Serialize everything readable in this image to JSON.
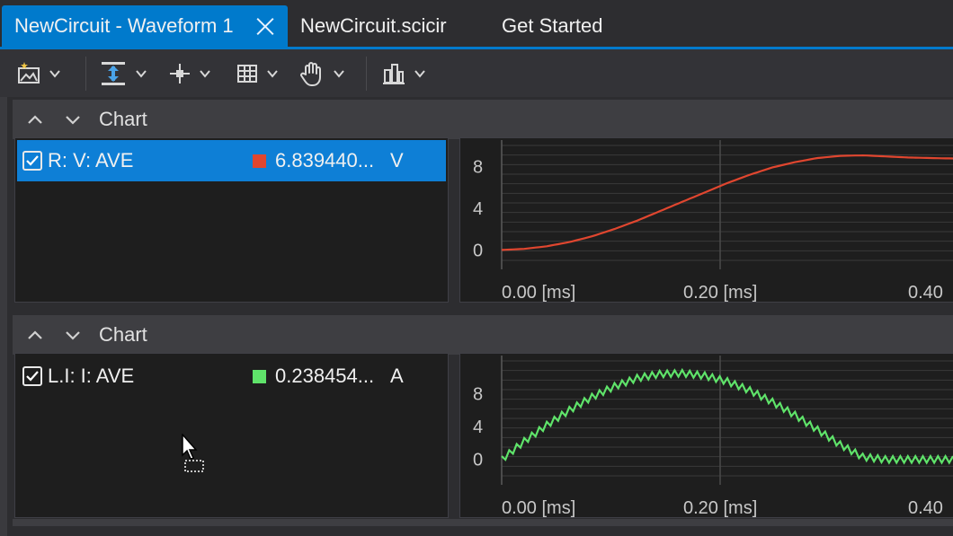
{
  "tabs": [
    {
      "label": "NewCircuit - Waveform 1",
      "active": true
    },
    {
      "label": "NewCircuit.scicir",
      "active": false
    },
    {
      "label": "Get Started",
      "active": false
    }
  ],
  "toolbar": {
    "buttons": [
      "add-image-icon",
      "fit-vertical-icon",
      "cursor-icon",
      "grid-icon",
      "pan-hand-icon",
      "bar-chart-icon"
    ]
  },
  "panels": [
    {
      "title": "Chart",
      "series": {
        "name": "R: V: AVE",
        "value": "6.839440...",
        "unit": "V",
        "color": "#e0462f",
        "selected": true,
        "checked": true
      },
      "chart_data": {
        "type": "line",
        "y_ticks": [
          "8",
          "4",
          "0"
        ],
        "x_ticks": [
          "0.00 [ms]",
          "0.20 [ms]",
          "0.40"
        ],
        "ylim": [
          -1,
          10
        ],
        "xlim": [
          0,
          0.4
        ],
        "series": [
          {
            "color": "#e0462f",
            "x": [
              0,
              0.02,
              0.04,
              0.06,
              0.08,
              0.1,
              0.12,
              0.14,
              0.16,
              0.18,
              0.2,
              0.22,
              0.24,
              0.26,
              0.28,
              0.3,
              0.32,
              0.34,
              0.36,
              0.38,
              0.4
            ],
            "y": [
              0,
              0.1,
              0.35,
              0.75,
              1.3,
              2.0,
              2.8,
              3.7,
              4.6,
              5.5,
              6.4,
              7.2,
              7.9,
              8.4,
              8.8,
              9.0,
              9.05,
              8.95,
              8.85,
              8.8,
              8.75
            ]
          }
        ]
      }
    },
    {
      "title": "Chart",
      "series": {
        "name": "L.I: I: AVE",
        "value": "0.238454...",
        "unit": "A",
        "color": "#5fe36a",
        "selected": false,
        "checked": true
      },
      "chart_data": {
        "type": "line",
        "y_ticks": [
          "8",
          "4",
          "0"
        ],
        "x_ticks": [
          "0.00 [ms]",
          "0.20 [ms]",
          "0.40"
        ],
        "ylim": [
          -2,
          12
        ],
        "xlim": [
          0,
          0.4
        ],
        "series": [
          {
            "color": "#5fe36a",
            "x": [
              0,
              0.02,
              0.04,
              0.06,
              0.08,
              0.1,
              0.12,
              0.14,
              0.16,
              0.18,
              0.2,
              0.22,
              0.24,
              0.26,
              0.28,
              0.3,
              0.32,
              0.34,
              0.36,
              0.38,
              0.4
            ],
            "y": [
              0,
              2.2,
              4.2,
              6.0,
              7.6,
              8.9,
              9.9,
              10.4,
              10.5,
              10.2,
              9.5,
              8.4,
              7.0,
              5.4,
              3.6,
              1.8,
              0.3,
              0,
              0,
              0,
              0
            ],
            "ripple": 0.5
          }
        ]
      }
    }
  ]
}
